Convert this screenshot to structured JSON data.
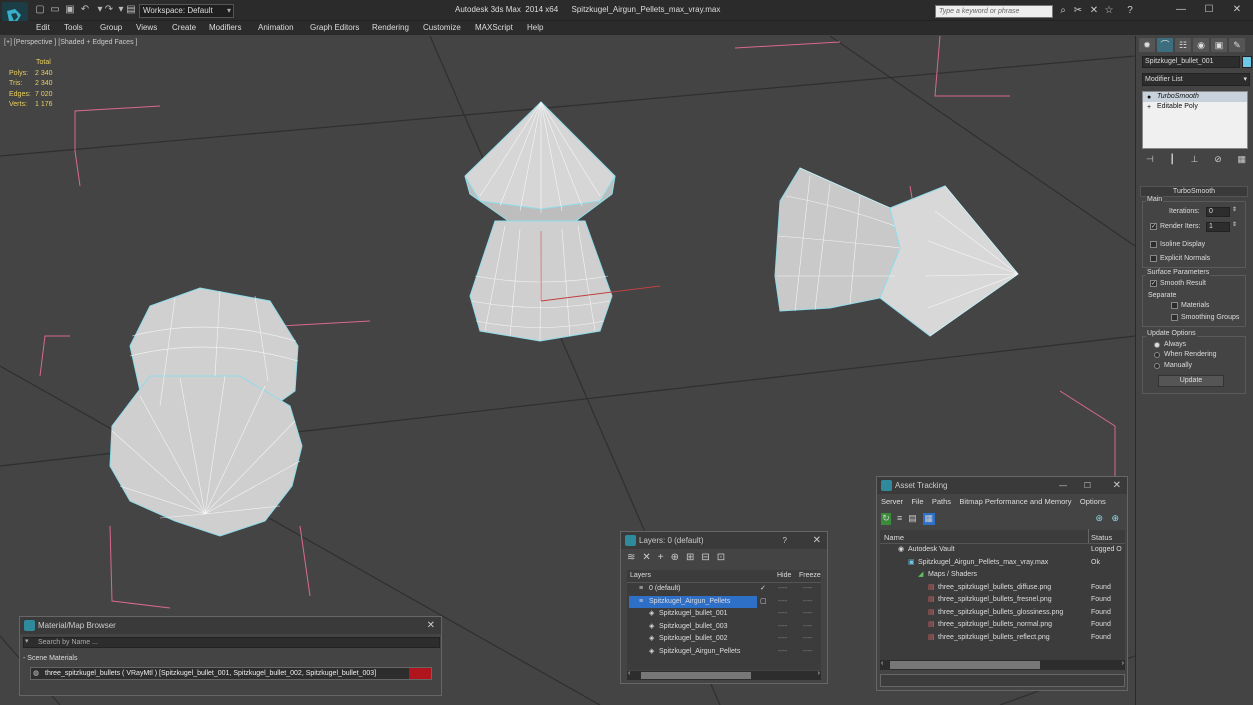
{
  "app": {
    "title": "Autodesk 3ds Max  2014 x64      Spitzkugel_Airgun_Pellets_max_vray.max",
    "workspace": "Workspace: Default",
    "search_placeholder": "Type a keyword or phrase"
  },
  "menu": [
    "Edit",
    "Tools",
    "Group",
    "Views",
    "Create",
    "Modifiers",
    "Animation",
    "Graph Editors",
    "Rendering",
    "Customize",
    "MAXScript",
    "Help"
  ],
  "viewport": {
    "label": "[+] [Perspective ] [Shaded + Edged Faces ]",
    "stats": {
      "header": "Total",
      "rows": [
        {
          "k": "Polys:",
          "v": "2 340"
        },
        {
          "k": "Tris:",
          "v": "2 340"
        },
        {
          "k": "Edges:",
          "v": "7 020"
        },
        {
          "k": "Verts:",
          "v": "1 176"
        }
      ]
    }
  },
  "command_panel": {
    "object_name": "Spitzkugel_bullet_001",
    "object_color": "#6ec6e8",
    "modifier_list": "Modifier List",
    "stack": [
      "TurboSmooth",
      "Editable Poly"
    ],
    "turbosmooth": {
      "title": "TurboSmooth",
      "main": "Main",
      "iterations_label": "Iterations:",
      "iterations": "0",
      "render_iters_label": "Render Iters:",
      "render_iters": "1",
      "isoline": "Isoline Display",
      "explicit_normals": "Explicit Normals",
      "surface_params": "Surface Parameters",
      "smooth_result": "Smooth Result",
      "separate": "Separate",
      "materials": "Materials",
      "smoothing_groups": "Smoothing Groups",
      "update_options": "Update Options",
      "always": "Always",
      "when_rendering": "When Rendering",
      "manually": "Manually",
      "update": "Update"
    }
  },
  "material_browser": {
    "title": "Material/Map Browser",
    "search": "Search by Name ...",
    "section": "- Scene Materials",
    "item": "three_spitzkugel_bullets  ( VRayMtl )  [Spitzkugel_bullet_001, Spitzkugel_bullet_002, Spitzkugel_bullet_003]"
  },
  "layers": {
    "title": "Layers: 0 (default)",
    "help": "?",
    "cols": [
      "Layers",
      "Hide",
      "Freeze"
    ],
    "rows": [
      {
        "name": "0 (default)",
        "level": 0
      },
      {
        "name": "Spitzkugel_Airgun_Pellets",
        "level": 0
      },
      {
        "name": "Spitzkugel_bullet_001",
        "level": 1
      },
      {
        "name": "Spitzkugel_bullet_003",
        "level": 1
      },
      {
        "name": "Spitzkugel_bullet_002",
        "level": 1
      },
      {
        "name": "Spitzkugel_Airgun_Pellets",
        "level": 1
      }
    ],
    "dash": "----"
  },
  "asset_tracking": {
    "title": "Asset Tracking",
    "menu": [
      "Server",
      "File",
      "Paths",
      "Bitmap Performance and Memory",
      "Options"
    ],
    "cols": [
      "Name",
      "Status"
    ],
    "rows": [
      {
        "name": "Autodesk Vault",
        "status": "Logged O",
        "level": 0
      },
      {
        "name": "Spitzkugel_Airgun_Pellets_max_vray.max",
        "status": "Ok",
        "level": 1
      },
      {
        "name": "Maps / Shaders",
        "status": "",
        "level": 2
      },
      {
        "name": "three_spitzkugel_bullets_diffuse.png",
        "status": "Found",
        "level": 3
      },
      {
        "name": "three_spitzkugel_bullets_fresnel.png",
        "status": "Found",
        "level": 3
      },
      {
        "name": "three_spitzkugel_bullets_glossiness.png",
        "status": "Found",
        "level": 3
      },
      {
        "name": "three_spitzkugel_bullets_normal.png",
        "status": "Found",
        "level": 3
      },
      {
        "name": "three_spitzkugel_bullets_reflect.png",
        "status": "Found",
        "level": 3
      }
    ]
  }
}
